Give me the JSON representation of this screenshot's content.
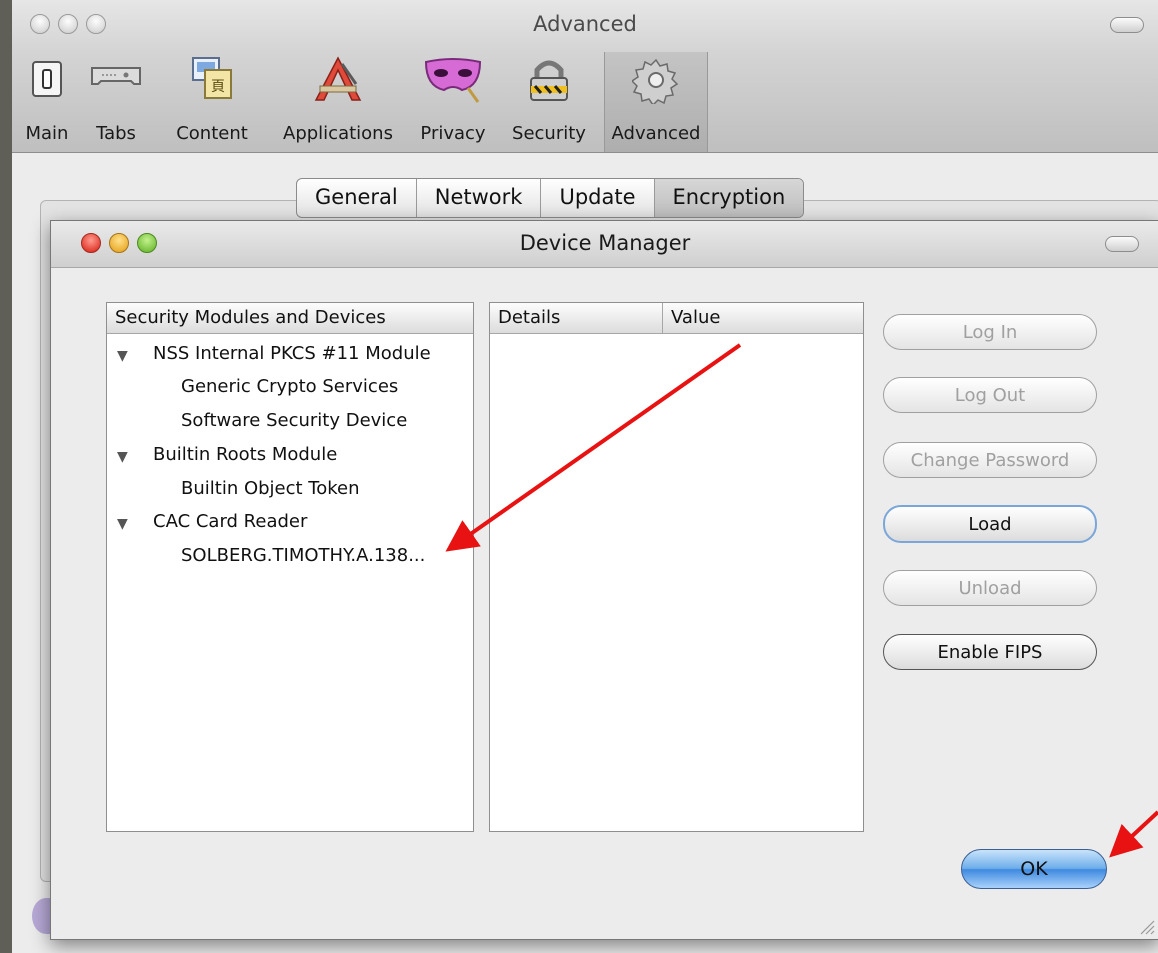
{
  "prefs_window": {
    "title": "Advanced",
    "toolbar": [
      {
        "label": "Main",
        "icon": "switch-icon"
      },
      {
        "label": "Tabs",
        "icon": "tabs-icon"
      },
      {
        "label": "Content",
        "icon": "content-icon"
      },
      {
        "label": "Applications",
        "icon": "applications-icon"
      },
      {
        "label": "Privacy",
        "icon": "mask-icon"
      },
      {
        "label": "Security",
        "icon": "padlock-icon"
      },
      {
        "label": "Advanced",
        "icon": "gear-icon"
      }
    ],
    "selected_toolbar_item": "Advanced",
    "tabs": [
      "General",
      "Network",
      "Update",
      "Encryption"
    ],
    "selected_tab": "Encryption"
  },
  "device_manager": {
    "title": "Device Manager",
    "modules_header": "Security Modules and Devices",
    "modules": [
      {
        "label": "NSS Internal PKCS #11 Module",
        "expanded": true,
        "children": [
          "Generic Crypto Services",
          "Software Security Device"
        ]
      },
      {
        "label": "Builtin Roots Module",
        "expanded": true,
        "children": [
          "Builtin Object Token"
        ]
      },
      {
        "label": "CAC Card Reader",
        "expanded": true,
        "children": [
          "SOLBERG.TIMOTHY.A.138..."
        ]
      }
    ],
    "details_headers": [
      "Details",
      "Value"
    ],
    "buttons": {
      "log_in": "Log In",
      "log_out": "Log Out",
      "change_password": "Change Password",
      "load": "Load",
      "unload": "Unload",
      "enable_fips": "Enable FIPS"
    },
    "ok_label": "OK"
  },
  "colors": {
    "annotation_arrow": "#e81212",
    "ok_button_blue": "#3f8ae0",
    "close_red": "#d8190d",
    "minimize_yellow": "#e39c12",
    "zoom_green": "#5dae23"
  }
}
